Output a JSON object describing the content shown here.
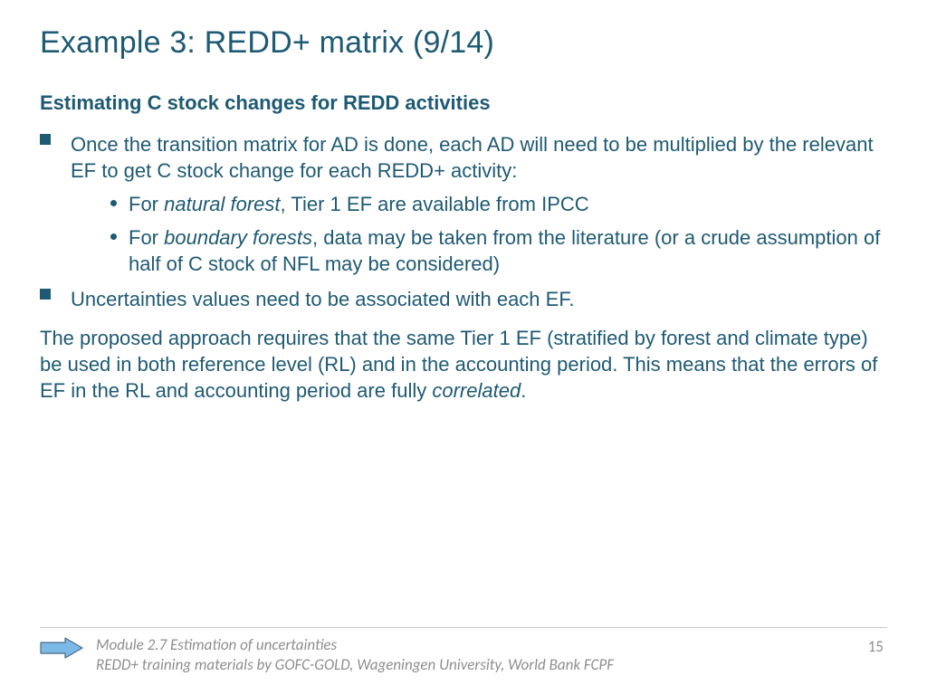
{
  "title": "Example 3: REDD+ matrix (9/14)",
  "subtitle": "Estimating C stock changes for REDD activities",
  "bullets": [
    {
      "text": "Once the transition matrix for AD is done, each AD will need to be multiplied by the relevant EF to get C stock change for each REDD+ activity:",
      "sub": [
        {
          "pre": "For ",
          "em": "natural forest",
          "post": ", Tier 1 EF are available from IPCC"
        },
        {
          "pre": "For ",
          "em": "boundary forests",
          "post": ", data may be taken from the literature (or a crude assumption of half of C stock of NFL may be considered)"
        }
      ]
    },
    {
      "text": "Uncertainties values need to be associated with each EF.",
      "sub": []
    }
  ],
  "paragraph": {
    "pre": "The proposed approach requires that the same Tier 1 EF (stratified by forest and climate type) be used in both reference level (RL) and in the accounting period.  This means that the errors of EF in the RL and accounting period are fully ",
    "em": "correlated",
    "post": "."
  },
  "footer": {
    "line1": "Module 2.7 Estimation of uncertainties",
    "line2": "REDD+ training materials by GOFC-GOLD, Wageningen University, World Bank FCPF",
    "page": "15"
  },
  "colors": {
    "text": "#1e5a73",
    "footerText": "#8e8e8e",
    "arrowFill": "#7bb9e6",
    "arrowStroke": "#4a6a88"
  }
}
